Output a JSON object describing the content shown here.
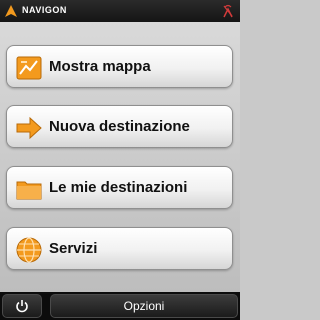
{
  "header": {
    "brand": "NAVIGON",
    "logo_icon": "navigon-logo-icon",
    "status_icon": "gps-signal-icon"
  },
  "menu": {
    "items": [
      {
        "label": "Mostra mappa",
        "icon": "map-icon"
      },
      {
        "label": "Nuova destinazione",
        "icon": "arrow-right-icon"
      },
      {
        "label": "Le mie destinazioni",
        "icon": "folder-icon"
      },
      {
        "label": "Servizi",
        "icon": "globe-icon"
      }
    ]
  },
  "footer": {
    "power_icon": "power-icon",
    "options_label": "Opzioni"
  },
  "colors": {
    "accent": "#f39a1e",
    "topbar": "#1e1e1e",
    "background": "#c9c9c9"
  }
}
